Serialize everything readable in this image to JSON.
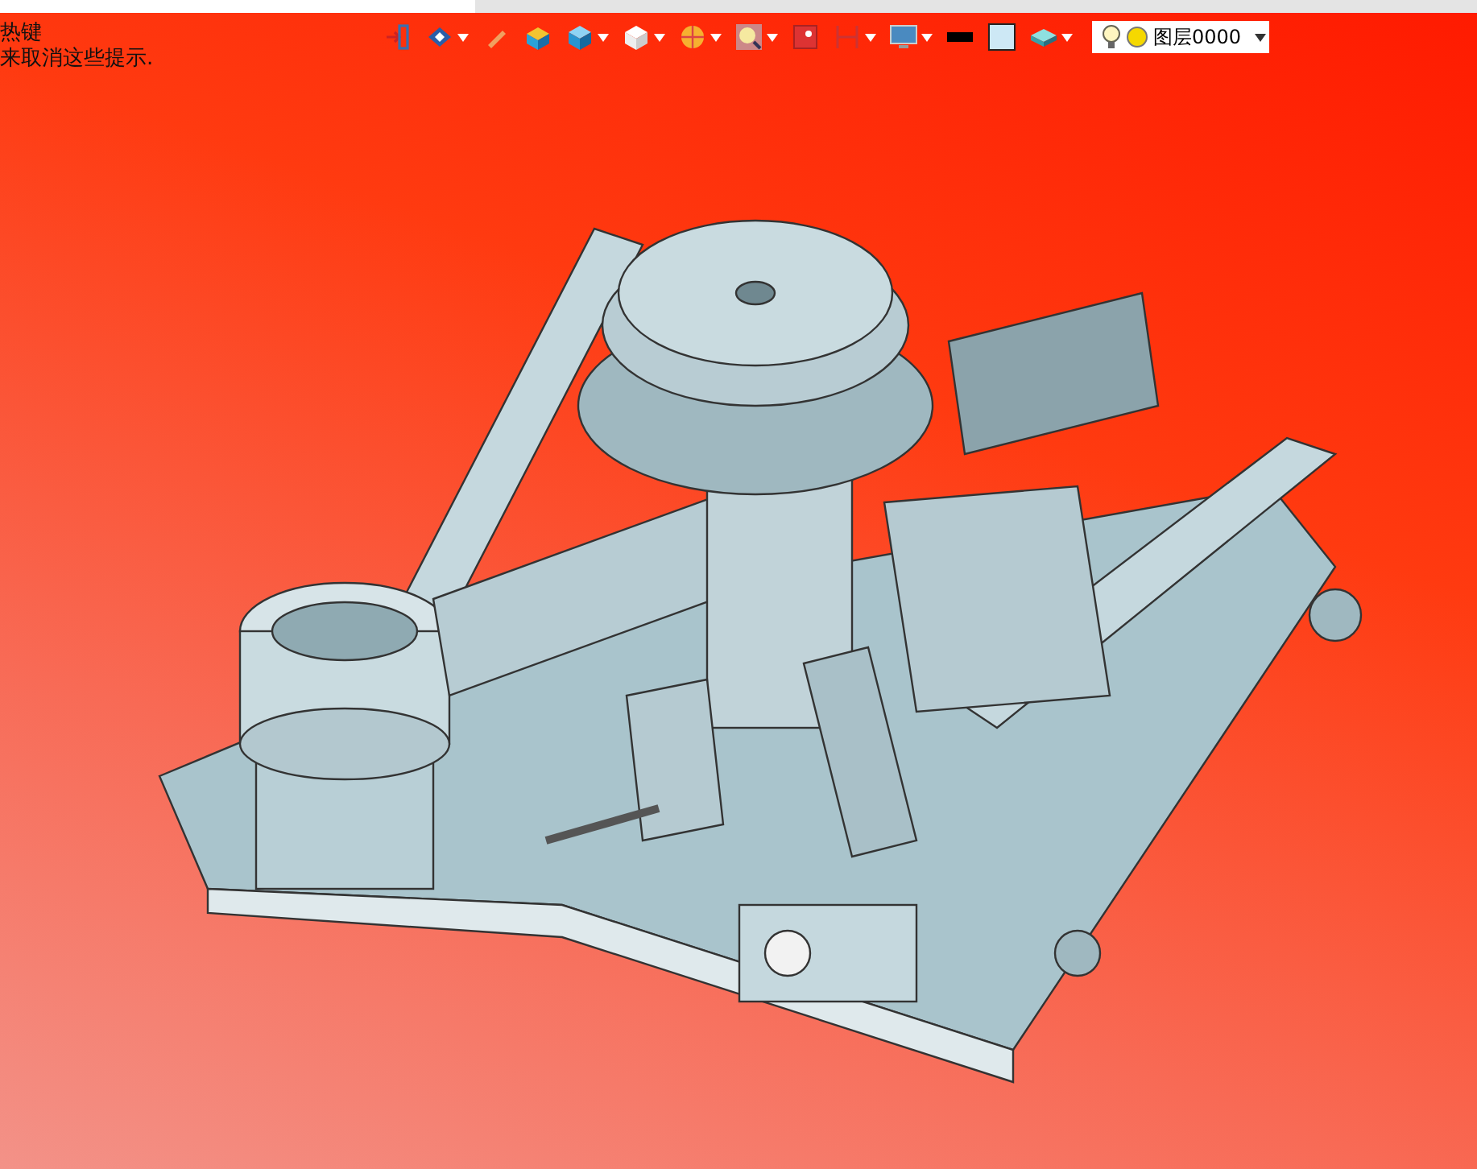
{
  "hints": [
    "热键",
    "来取消这些提示."
  ],
  "toolbar": [
    {
      "kind": "exit",
      "dropdown": false
    },
    {
      "kind": "view",
      "dropdown": true
    },
    {
      "kind": "pencil",
      "dropdown": false
    },
    {
      "kind": "shaded",
      "dropdown": false
    },
    {
      "kind": "cube",
      "dropdown": true
    },
    {
      "kind": "whitecube",
      "dropdown": true
    },
    {
      "kind": "pie",
      "dropdown": true
    },
    {
      "kind": "zoom",
      "dropdown": true
    },
    {
      "kind": "fit",
      "dropdown": false
    },
    {
      "kind": "dimension",
      "dropdown": true
    },
    {
      "kind": "display",
      "dropdown": true
    },
    {
      "kind": "line",
      "dropdown": false
    },
    {
      "kind": "color",
      "dropdown": false
    },
    {
      "kind": "slab",
      "dropdown": true
    }
  ],
  "layer": {
    "value": "图层0000"
  }
}
